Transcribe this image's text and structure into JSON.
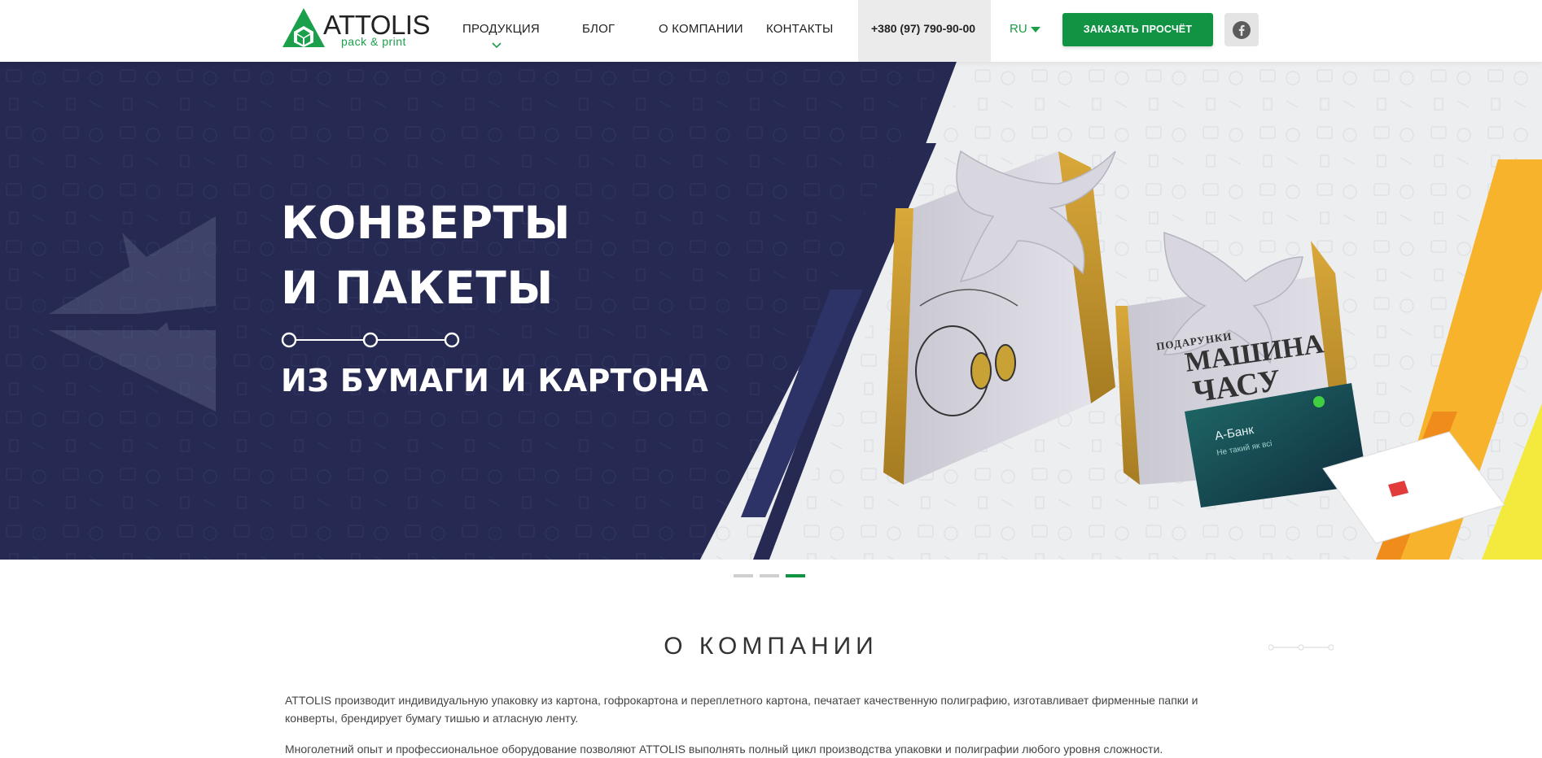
{
  "header": {
    "logo_name": "ATTOLIS",
    "logo_sub": "pack & print",
    "nav": [
      "ПРОДУКЦИЯ",
      "БЛОГ",
      "О КОМПАНИИ",
      "КОНТАКТЫ"
    ],
    "phone": "+380 (97) 790-90-00",
    "lang": "RU",
    "order_label": "ЗАКАЗАТЬ ПРОСЧЁТ"
  },
  "hero": {
    "title_line1": "КОНВЕРТЫ",
    "title_line2": "И ПАКЕТЫ",
    "subtitle": "ИЗ БУМАГИ И КАРТОНА",
    "bag_label_top": "ПОДАРУНКИ",
    "bag_label_main1": "МАШИНА",
    "bag_label_main2": "ЧАСУ",
    "card_title": "А-Банк",
    "card_sub": "Не такий як всі"
  },
  "slider": {
    "count": 3,
    "active_index": 2
  },
  "about": {
    "title": "О КОМПАНИИ",
    "paragraph1": "ATTOLIS производит индивидуальную упаковку из картона, гофрокартона и переплетного картона, печатает качественную полиграфию, изготавливает фирменные папки и конверты, брендирует бумагу тишью и атласную ленту.",
    "paragraph2": "Многолетний опыт и профессиональное оборудование позволяют ATTOLIS выполнять полный цикл производства упаковки и полиграфии любого уровня сложности."
  },
  "colors": {
    "brand_green": "#109444",
    "hero_navy": "#262a52",
    "accent_yellow": "#f7b32b"
  }
}
